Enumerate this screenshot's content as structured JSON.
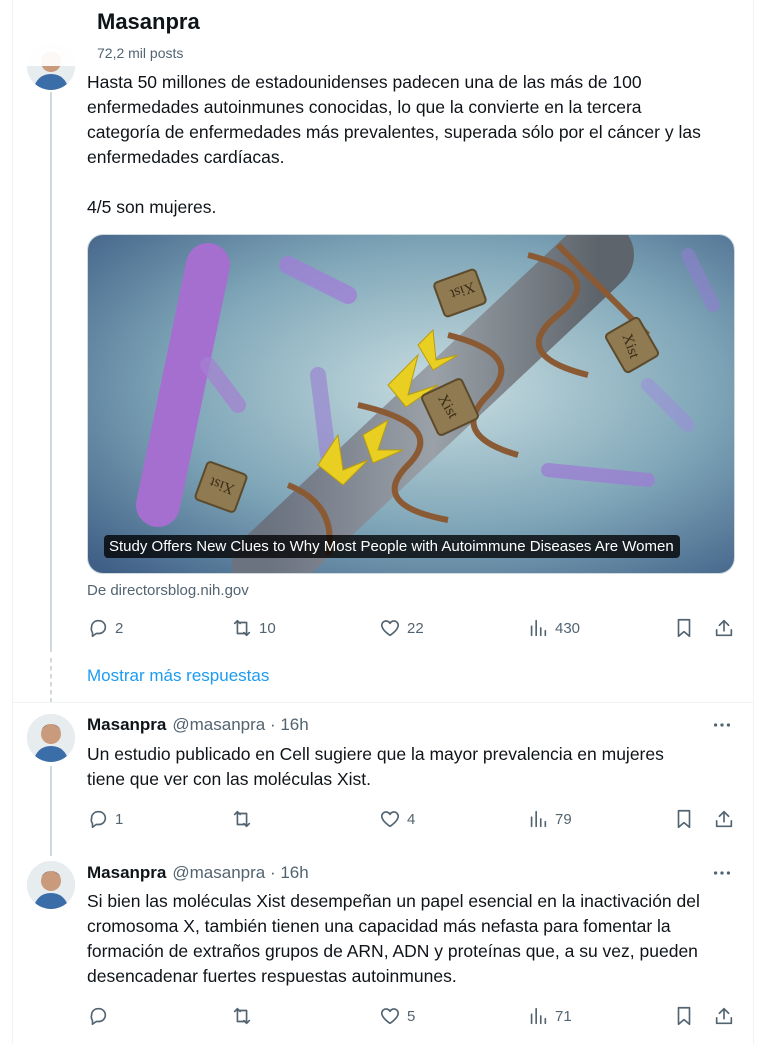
{
  "header": {
    "title": "Masanpra",
    "subtitle": "72,2 mil posts"
  },
  "post1": {
    "text_lines": [
      "Hasta 50 millones de estadounidenses padecen una de las más de 100",
      "enfermedades autoinmunes conocidas, lo que la convierte en la tercera",
      "categoría de enfermedades más prevalentes, superada sólo por el cáncer y las",
      "enfermedades cardíacas.",
      "",
      "4/5 son mujeres."
    ],
    "card_caption": "Study Offers New Clues to Why Most People with Autoimmune Diseases Are Women",
    "card_source": "De directorsblog.nih.gov",
    "card_image_labels": [
      "Xist",
      "Xist",
      "Xist",
      "Xist"
    ],
    "stats": {
      "replies": "2",
      "reposts": "10",
      "likes": "22",
      "views": "430"
    }
  },
  "show_more": "Mostrar más respuestas",
  "post2": {
    "name": "Masanpra",
    "handle_time": "@masanpra · 16h",
    "text_lines": [
      "Un estudio publicado en Cell sugiere que la mayor prevalencia en mujeres",
      "tiene que ver con las moléculas Xist."
    ],
    "stats": {
      "replies": "1",
      "reposts": "",
      "likes": "4",
      "views": "79"
    }
  },
  "post3": {
    "name": "Masanpra",
    "handle_time": "@masanpra · 16h",
    "text_lines": [
      "Si bien las moléculas Xist desempeñan un papel esencial en la inactivación del",
      "cromosoma X, también tienen una capacidad más nefasta para fomentar la",
      "formación de extraños grupos de ARN, ADN y proteínas que, a su vez, pueden",
      "desencadenar fuertes respuestas autoinmunes."
    ],
    "stats": {
      "replies": "",
      "reposts": "",
      "likes": "5",
      "views": "71"
    }
  },
  "icons": [
    "reply-icon",
    "repost-icon",
    "like-icon",
    "views-icon",
    "bookmark-icon",
    "share-icon",
    "more-icon"
  ],
  "colors": {
    "link": "#1d9bf0",
    "secondary_text": "#536471",
    "text": "#0f1419"
  }
}
